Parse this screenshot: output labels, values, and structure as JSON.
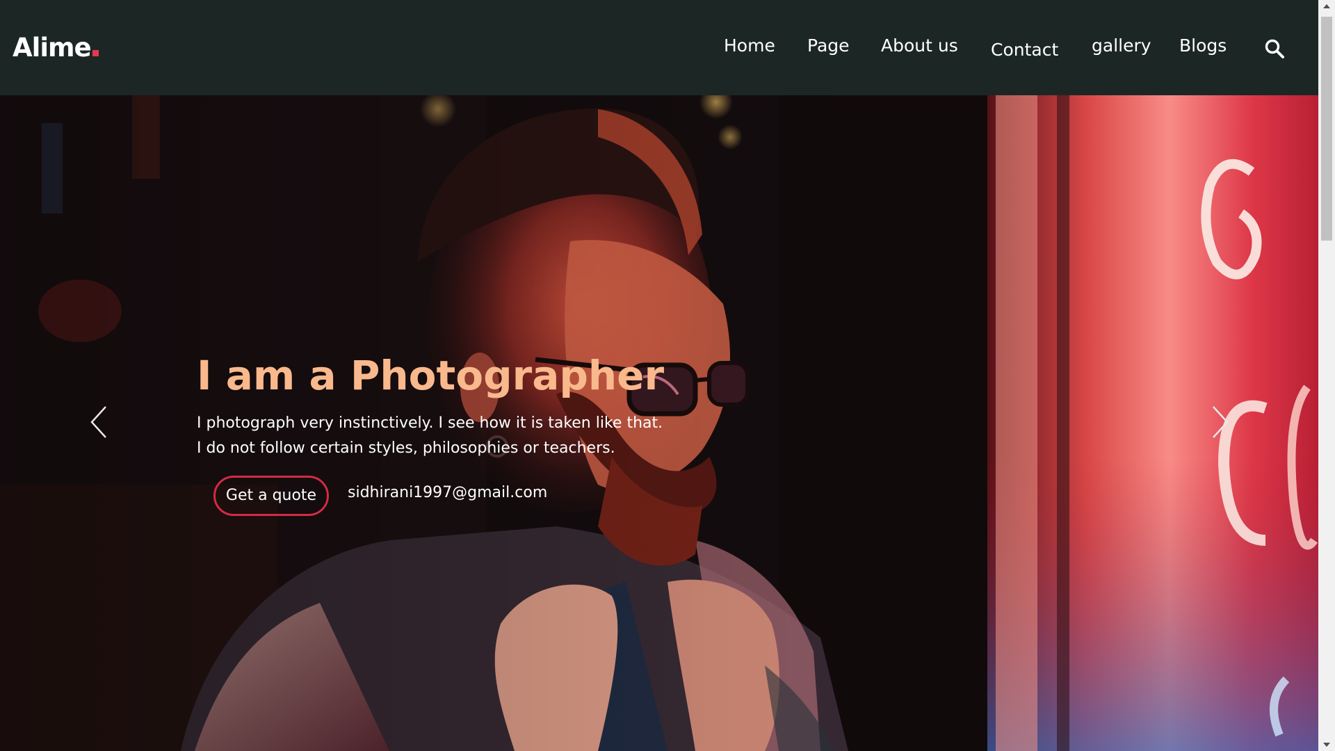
{
  "header": {
    "logo_text": "Alime",
    "nav": [
      "Home",
      "Page",
      "About us",
      "Contact",
      "gallery",
      "Blogs"
    ],
    "search_icon": "search-icon"
  },
  "hero": {
    "image": "man-with-glasses-neon-light-photo",
    "title": "I am a Photographer",
    "description": "I photograph very instinctively. I see how it is taken like that. I do not follow certain styles, philosophies or teachers.",
    "cta_label": "Get a quote",
    "email": "sidhirani1997@gmail.com",
    "prev_icon": "chevron-left-icon",
    "next_icon": "chevron-right-icon"
  },
  "colors": {
    "header_bg": "#1c2725",
    "accent_red": "#e8384f",
    "title_peach": "#f9b98c"
  }
}
